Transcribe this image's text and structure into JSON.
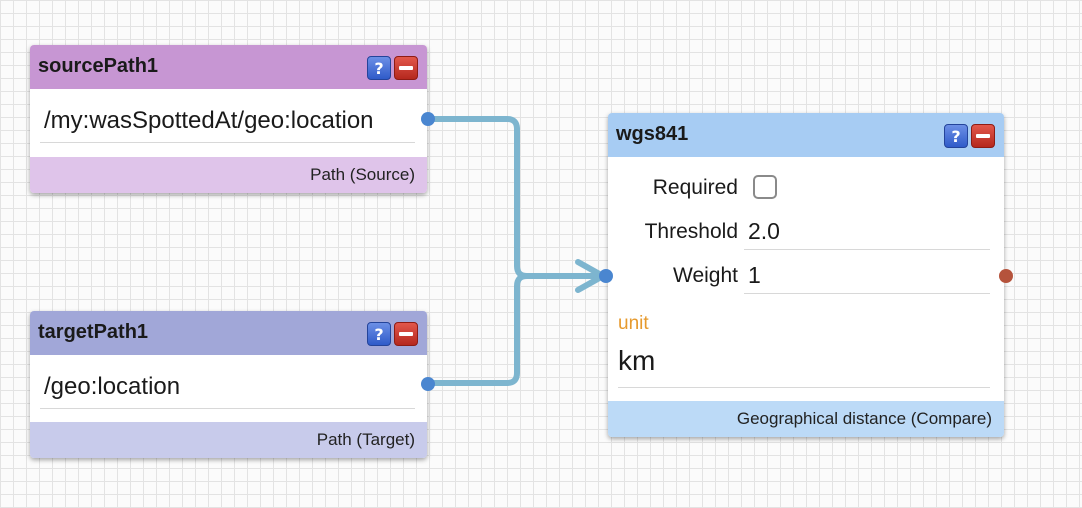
{
  "nodes": {
    "source": {
      "title": "sourcePath1",
      "path": "/my:wasSpottedAt/geo:location",
      "type_label": "Path (Source)"
    },
    "target": {
      "title": "targetPath1",
      "path": "/geo:location",
      "type_label": "Path (Target)"
    },
    "compare": {
      "title": "wgs841",
      "required_label": "Required",
      "required_checked": false,
      "threshold_label": "Threshold",
      "threshold_value": "2.0",
      "weight_label": "Weight",
      "weight_value": "1",
      "unit_label": "unit",
      "unit_value": "km",
      "type_label": "Geographical distance (Compare)"
    }
  },
  "buttons": {
    "help_glyph": "?"
  },
  "colors": {
    "source_header": "#c796d3",
    "source_footer": "#dfc4ea",
    "target_header": "#a1a7d8",
    "target_footer": "#c8cbeb",
    "compare_header": "#a7ccf3",
    "compare_footer": "#bcdaf7",
    "connector": "#7db5cf",
    "input_port": "#4a86d0",
    "output_port": "#b5533c",
    "unit_label": "#e69a2e"
  },
  "icons": [
    "help-icon",
    "remove-icon",
    "arrow-icon"
  ]
}
